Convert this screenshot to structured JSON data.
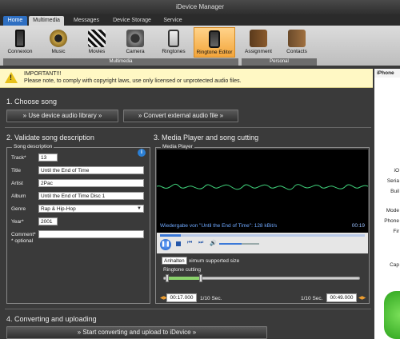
{
  "window": {
    "title": "iDevice Manager"
  },
  "tabs": [
    {
      "label": "Home"
    },
    {
      "label": "Multimedia"
    },
    {
      "label": "Messages"
    },
    {
      "label": "Device Storage"
    },
    {
      "label": "Service"
    }
  ],
  "ribbon": {
    "buttons": [
      {
        "label": "Connexion"
      },
      {
        "label": "Music"
      },
      {
        "label": "Movies"
      },
      {
        "label": "Camera"
      },
      {
        "label": "Ringtones"
      },
      {
        "label": "Ringtone Editor"
      },
      {
        "label": "Assignment"
      },
      {
        "label": "Contacts"
      }
    ],
    "groups": {
      "multimedia": "Multimedia",
      "personal": "Personal"
    }
  },
  "notice": {
    "title": "IMPORTANT!!!",
    "text": "Please note, to comply with copyright laws, use only licensed or unprotected audio files."
  },
  "sidepanel": {
    "heading": "iPhone",
    "snippets": [
      "iO",
      "Seria",
      "Buil",
      "Mode",
      "Phone",
      "Fir",
      "Cap"
    ]
  },
  "choose": {
    "heading": "1. Choose song",
    "library_button": "» Use device audio library »",
    "convert_button": "» Convert external audio file »"
  },
  "validate": {
    "heading": "2. Validate song description",
    "groupbox": "Song description",
    "fields": {
      "track": {
        "label": "Track*",
        "value": "13"
      },
      "title": {
        "label": "Title",
        "value": "Until the End of Time"
      },
      "artist": {
        "label": "Artist",
        "value": "2Pac"
      },
      "album": {
        "label": "Album",
        "value": "Until the End of Time Disc 1"
      },
      "genre": {
        "label": "Genre",
        "value": "Rap & Hip-Hop"
      },
      "year": {
        "label": "Year*",
        "value": "2001"
      },
      "comment": {
        "label": "Comment*",
        "value": ""
      }
    },
    "optional_note": "* optional"
  },
  "media": {
    "heading": "3. Media Player and song cutting",
    "groupbox": "Media Player",
    "status": "Wiedergabe von \"Until the End of Time\": 128 kBit/s",
    "time": "00:19",
    "tooltip": "Anhalten",
    "max_size_text": "ximum supported size",
    "cutting_label": "Ringtone cutting",
    "start_time": "00:17.000",
    "end_time": "00:49.000",
    "step_left": "1/10 Sec.",
    "step_right": "1/10 Sec.",
    "progress": 0.1,
    "volume": 0.55,
    "cut_start": 0.02,
    "cut_end": 0.19
  },
  "upload": {
    "heading": "4. Converting and uploading",
    "button": "» Start converting and upload to iDevice »"
  },
  "colors": {
    "accent": "#2e6fc2",
    "active_ribbon": "#f3a53a",
    "wave": "#3fd07a"
  }
}
